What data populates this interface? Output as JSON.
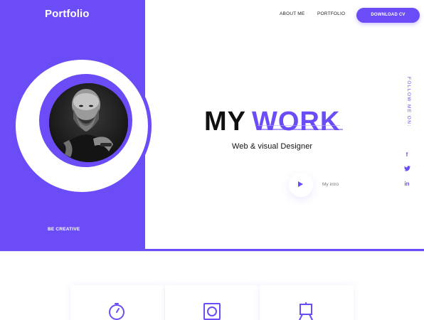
{
  "header": {
    "logo": "Portfolio",
    "nav": [
      {
        "label": "ABOUT ME"
      },
      {
        "label": "PORTFOLIO"
      }
    ],
    "cta_label": "DOWNLOAD CV"
  },
  "hero": {
    "title_part1": "MY",
    "title_part2": "WORK",
    "subtitle": "Web & visual Designer",
    "intro_label": "My intro",
    "tagline": "BE CREATIVE",
    "follow_label": "FOLLOW ME ON:",
    "social": [
      {
        "icon": "facebook-icon",
        "glyph": "f"
      },
      {
        "icon": "twitter-icon",
        "glyph": "t"
      },
      {
        "icon": "linkedin-icon",
        "glyph": "in"
      }
    ]
  },
  "services": [
    {
      "icon": "timer-icon"
    },
    {
      "icon": "frame-icon"
    },
    {
      "icon": "easel-icon"
    }
  ],
  "colors": {
    "accent": "#6b4cf6",
    "text": "#111111",
    "background": "#ffffff"
  }
}
